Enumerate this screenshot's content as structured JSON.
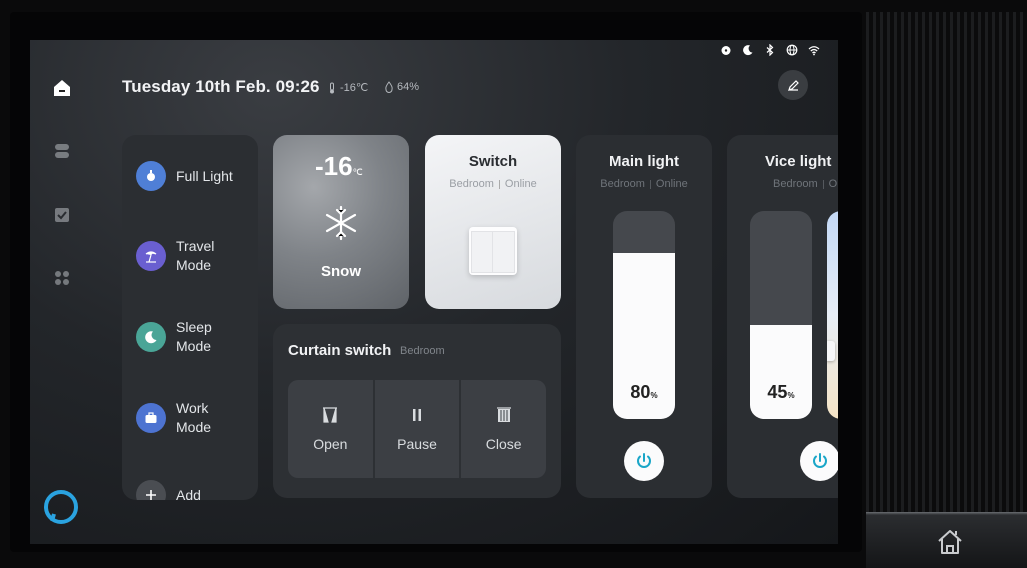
{
  "status_bar": {
    "icons": [
      "alarm-icon",
      "moon-icon",
      "bluetooth-icon",
      "globe-icon",
      "wifi-icon"
    ]
  },
  "header": {
    "date_time": "Tuesday 10th Feb. 09:26",
    "temperature": "-16℃",
    "humidity": "64%"
  },
  "nav": {
    "items": [
      "home-icon",
      "devices-icon",
      "tasks-icon",
      "apps-icon"
    ]
  },
  "scenes": [
    {
      "label": "Full Light",
      "icon": "bulb-icon",
      "color": "#4f7fd6"
    },
    {
      "label": "Travel\nMode",
      "icon": "palm-icon",
      "color": "#6a5fd0"
    },
    {
      "label": "Sleep\nMode",
      "icon": "moon-icon",
      "color": "#4aa597"
    },
    {
      "label": "Work\nMode",
      "icon": "briefcase-icon",
      "color": "#4d73d1"
    },
    {
      "label": "Add",
      "icon": "plus-icon",
      "color": "#4a4d52"
    }
  ],
  "weather": {
    "temp": "-16",
    "unit": "℃",
    "condition": "Snow"
  },
  "switch_card": {
    "title": "Switch",
    "room": "Bedroom",
    "state": "Online"
  },
  "curtain": {
    "title": "Curtain switch",
    "room": "Bedroom",
    "buttons": [
      {
        "label": "Open"
      },
      {
        "label": "Pause"
      },
      {
        "label": "Close"
      }
    ]
  },
  "main_light": {
    "title": "Main light",
    "room": "Bedroom",
    "state": "Online",
    "brightness": "80",
    "unit": "%",
    "level": 0.8
  },
  "vice_light": {
    "title": "Vice light",
    "room": "Bedroom",
    "state": "Online",
    "brightness": "45",
    "unit": "%",
    "level": 0.45
  }
}
